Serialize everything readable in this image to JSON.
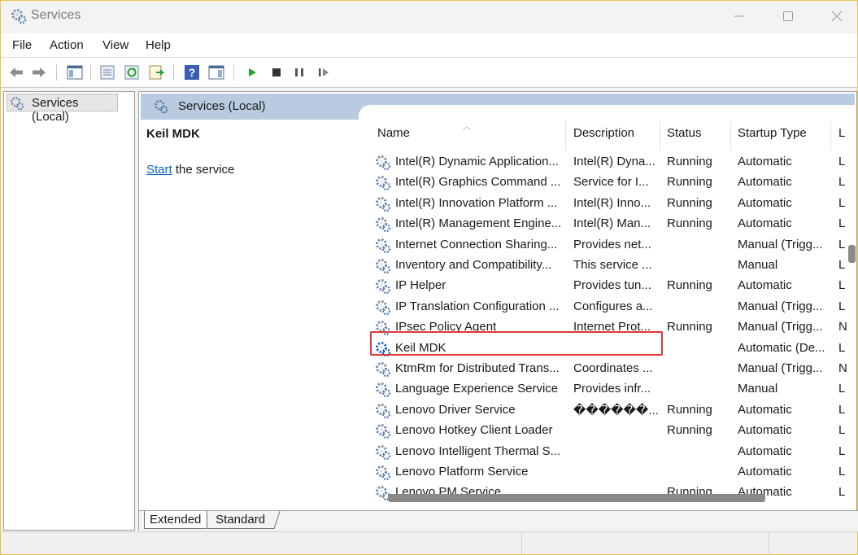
{
  "window": {
    "title": "Services",
    "icon": "services-gear-icon",
    "controls": [
      "minimize-icon",
      "maximize-icon",
      "close-icon"
    ]
  },
  "menu": [
    "File",
    "Action",
    "View",
    "Help"
  ],
  "toolbar": {
    "buttons": [
      "back-arrow-icon",
      "forward-arrow-icon",
      "console-tree-icon",
      "properties-icon",
      "refresh-icon",
      "export-list-icon",
      "help-icon",
      "show-hide-pane-icon",
      "start-service-icon",
      "stop-service-icon",
      "pause-service-icon",
      "restart-service-icon"
    ]
  },
  "tree": {
    "root_label": "Services (Local)"
  },
  "pane": {
    "header": "Services (Local)",
    "selected_service": "Keil MDK",
    "action_link": "Start",
    "action_rest": " the service"
  },
  "list": {
    "columns": [
      "Name",
      "Description",
      "Status",
      "Startup Type",
      "L"
    ],
    "rows": [
      {
        "name": "Intel(R) Dynamic Application...",
        "desc": "Intel(R) Dyna...",
        "status": "Running",
        "startup": "Automatic",
        "log": "L"
      },
      {
        "name": "Intel(R) Graphics Command ...",
        "desc": "Service for I...",
        "status": "Running",
        "startup": "Automatic",
        "log": "L"
      },
      {
        "name": "Intel(R) Innovation Platform ...",
        "desc": "Intel(R) Inno...",
        "status": "Running",
        "startup": "Automatic",
        "log": "L"
      },
      {
        "name": "Intel(R) Management Engine...",
        "desc": "Intel(R) Man...",
        "status": "Running",
        "startup": "Automatic",
        "log": "L"
      },
      {
        "name": "Internet Connection Sharing...",
        "desc": "Provides net...",
        "status": "",
        "startup": "Manual (Trigg...",
        "log": "L"
      },
      {
        "name": "Inventory and Compatibility...",
        "desc": "This service ...",
        "status": "",
        "startup": "Manual",
        "log": "L"
      },
      {
        "name": "IP Helper",
        "desc": "Provides tun...",
        "status": "Running",
        "startup": "Automatic",
        "log": "L"
      },
      {
        "name": "IP Translation Configuration ...",
        "desc": "Configures a...",
        "status": "",
        "startup": "Manual (Trigg...",
        "log": "L"
      },
      {
        "name": "IPsec Policy Agent",
        "desc": "Internet Prot...",
        "status": "Running",
        "startup": "Manual (Trigg...",
        "log": "N"
      },
      {
        "name": "Keil  MDK",
        "desc": "",
        "status": "",
        "startup": "Automatic (De...",
        "log": "L"
      },
      {
        "name": "KtmRm for Distributed Trans...",
        "desc": "Coordinates ...",
        "status": "",
        "startup": "Manual (Trigg...",
        "log": "N"
      },
      {
        "name": "Language Experience Service",
        "desc": "Provides infr...",
        "status": "",
        "startup": "Manual",
        "log": "L"
      },
      {
        "name": "Lenovo Driver Service",
        "desc": "������...",
        "status": "Running",
        "startup": "Automatic",
        "log": "L"
      },
      {
        "name": "Lenovo Hotkey Client Loader",
        "desc": "",
        "status": "Running",
        "startup": "Automatic",
        "log": "L"
      },
      {
        "name": "Lenovo Intelligent Thermal S...",
        "desc": "",
        "status": "",
        "startup": "Automatic",
        "log": "L"
      },
      {
        "name": "Lenovo Platform Service",
        "desc": "",
        "status": "",
        "startup": "Automatic",
        "log": "L"
      },
      {
        "name": "Lenovo PM Service",
        "desc": "",
        "status": "Running",
        "startup": "Automatic",
        "log": "L"
      }
    ],
    "highlighted_service": "Keil  MDK",
    "highlight_color": "#e0363a"
  },
  "view_tabs": [
    "Extended",
    "Standard"
  ],
  "colors": {
    "pane_header": "#b9cbe0",
    "link": "#0066cc",
    "window_border": "#e8c24a"
  }
}
